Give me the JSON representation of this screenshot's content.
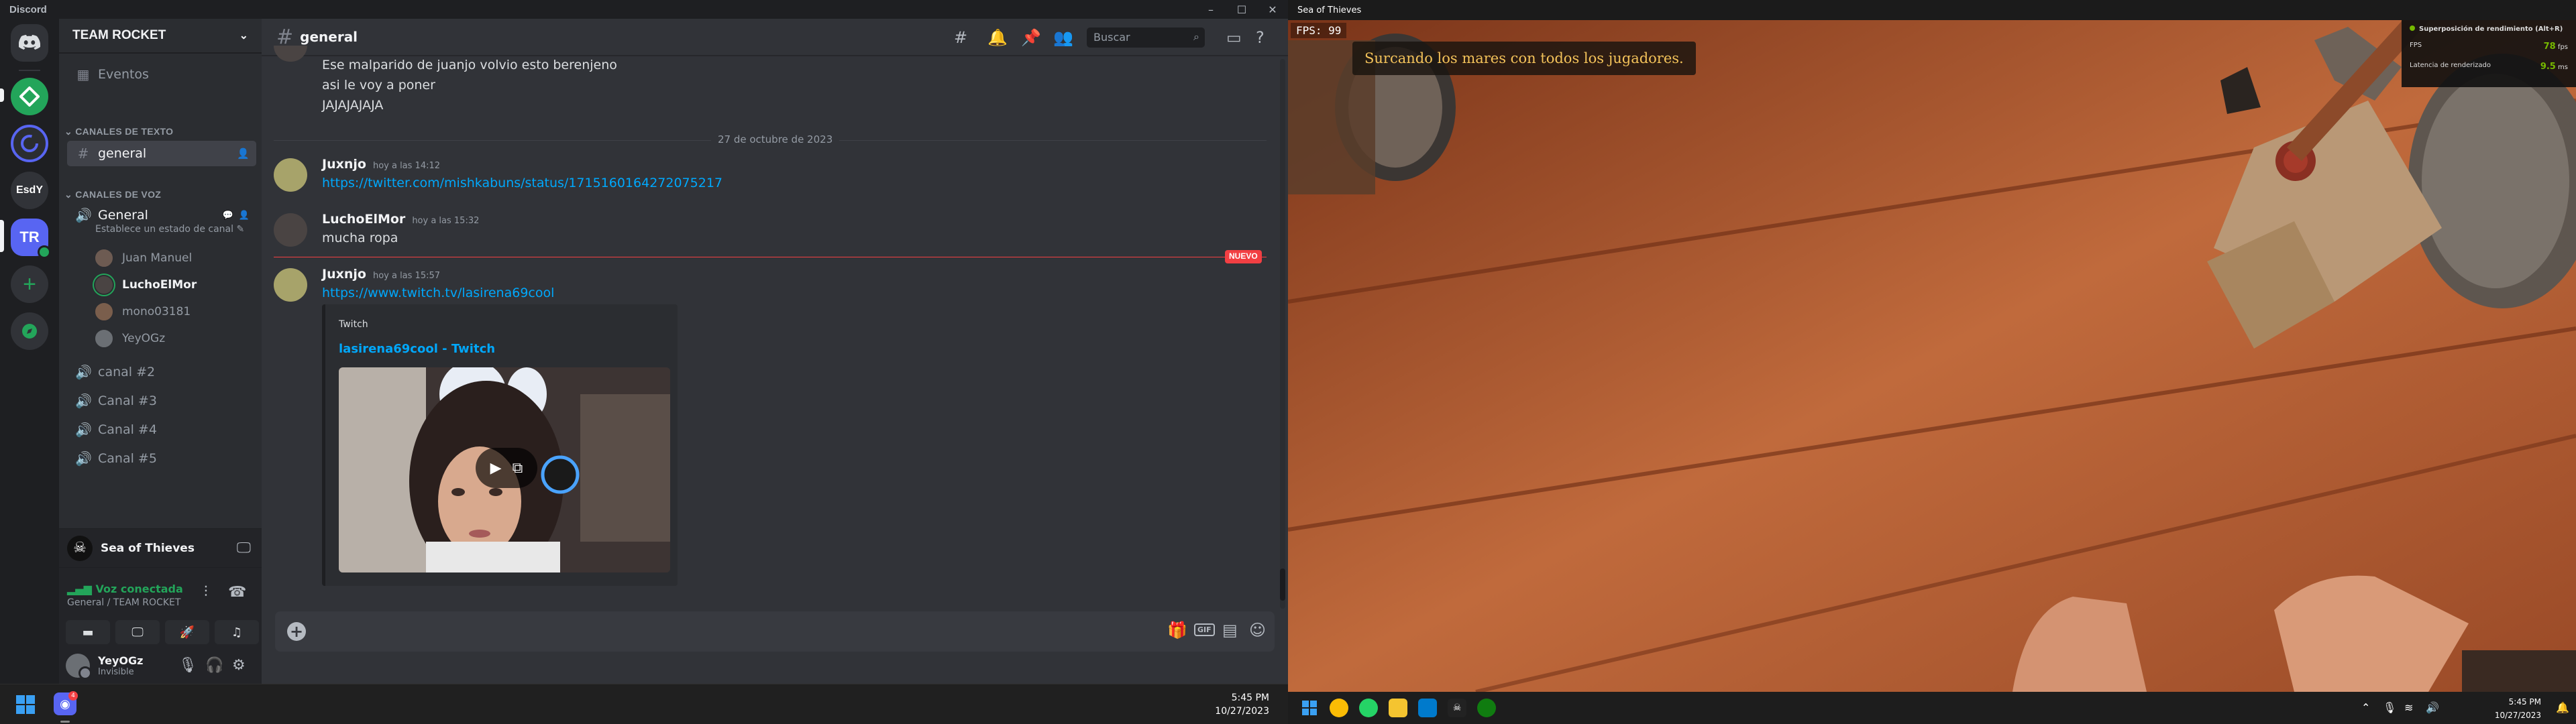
{
  "discord": {
    "app_title": "Discord",
    "window_controls": [
      "–",
      "☐",
      "✕"
    ],
    "servers": {
      "home_icon": "discord-logo",
      "s3_label": "EsdY",
      "s4_label": "TR",
      "add_icon": "+",
      "explore_icon": "compass"
    },
    "sidebar": {
      "server_name": "TEAM ROCKET",
      "events_label": "Eventos",
      "text_category": "CANALES DE TEXTO",
      "text_channel": "general",
      "voice_category": "CANALES DE VOZ",
      "voice_channel": "General",
      "channel_status": "Establece un estado de canal",
      "voice_users": [
        "Juan Manuel",
        "LuchoElMor",
        "mono03181",
        "YeyOGz"
      ],
      "other_channels": [
        "canal #2",
        "Canal #3",
        "Canal #4",
        "Canal #5"
      ]
    },
    "activity": {
      "game_name": "Sea of Thieves"
    },
    "voice_panel": {
      "status": "Voz conectada",
      "location": "General / TEAM ROCKET"
    },
    "user_panel": {
      "username": "YeyOGz",
      "status": "Invisible"
    },
    "chat": {
      "channel_name": "general",
      "search_placeholder": "Buscar",
      "earlier_lines": [
        "Ese malparido de juanjo volvio esto berenjeno",
        "asi le voy a poner",
        "JAJAJAJAJA"
      ],
      "date_divider": "27 de octubre de 2023",
      "messages": [
        {
          "author": "Juxnjo",
          "time": "hoy a las 14:12",
          "content": "https://twitter.com/mishkabuns/status/1715160164272075217"
        },
        {
          "author": "LuchoElMor",
          "time": "hoy a las 15:32",
          "content": "mucha ropa"
        },
        {
          "author": "Juxnjo",
          "time": "hoy a las 15:57",
          "content": "https://www.twitch.tv/lasirena69cool"
        }
      ],
      "new_badge": "NUEVO",
      "embed": {
        "provider": "Twitch",
        "title": "lasirena69cool - Twitch"
      },
      "composer_gif": "GIF"
    },
    "taskbar": {
      "time": "5:45 PM",
      "date": "10/27/2023",
      "notif_count": "4"
    }
  },
  "game": {
    "window_title": "Sea of Thieves",
    "fps_label": "FPS:",
    "fps_value": "99",
    "banner": "Surcando los mares con todos los jugadores.",
    "overlay": {
      "title": "Superposición de rendimiento (Alt+R)",
      "fps_label": "FPS",
      "fps_value": "78",
      "fps_unit": "fps",
      "latency_label": "Latencia de renderizado",
      "latency_value": "9.5",
      "latency_unit": "ms"
    },
    "taskbar": {
      "time": "5:45 PM",
      "date": "10/27/2023"
    }
  },
  "colors": {
    "discord_bg": "#313338",
    "sidebar_bg": "#2b2d31",
    "link": "#00a8fc",
    "green": "#23a55a",
    "new_red": "#f23f43",
    "banner_gold": "#f4c35a",
    "nvidia_green": "#76b900"
  }
}
